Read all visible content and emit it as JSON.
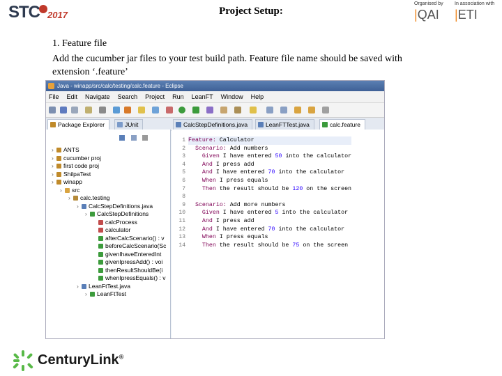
{
  "header": {
    "stc_logo": "STC",
    "stc_year": "2017",
    "title": "Project Setup:",
    "organised_by": "Organised by",
    "org_name": "QAI",
    "assoc_label": "In association with",
    "assoc_name": "ETI"
  },
  "content": {
    "heading": "1.   Feature file",
    "body": "Add the cucumber jar files to your test build path. Feature file name should be saved with extension ‘.feature’"
  },
  "eclipse": {
    "window_title": "Java - winapp/src/calc/testing/calc.feature - Eclipse",
    "menu": [
      "File",
      "Edit",
      "Navigate",
      "Search",
      "Project",
      "Run",
      "LeanFT",
      "Window",
      "Help"
    ],
    "tabs": {
      "package_explorer": "Package Explorer",
      "junit": "JUnit",
      "calc_step_defs": "CalcStepDefinitions.java",
      "leanft_test": "LeanFTTest.java",
      "calc_feature": "calc.feature"
    },
    "tree": [
      {
        "label": "ANTS",
        "indent": 0,
        "color": "#c08a2a"
      },
      {
        "label": "cucumber proj",
        "indent": 0,
        "color": "#c08a2a"
      },
      {
        "label": "first code proj",
        "indent": 0,
        "color": "#c08a2a"
      },
      {
        "label": "ShilpaTest",
        "indent": 0,
        "color": "#c08a2a"
      },
      {
        "label": "winapp",
        "indent": 0,
        "color": "#c08a2a"
      },
      {
        "label": "src",
        "indent": 1,
        "color": "#d9a441"
      },
      {
        "label": "calc.testing",
        "indent": 2,
        "color": "#b58a3a"
      },
      {
        "label": "CalcStepDefinitions.java",
        "indent": 3,
        "color": "#5a7fb8"
      },
      {
        "label": "CalcStepDefinitions",
        "indent": 4,
        "color": "#3c9b3c"
      },
      {
        "label": "calcProcess",
        "indent": 5,
        "color": "#c24c4c"
      },
      {
        "label": "calculator",
        "indent": 5,
        "color": "#c24c4c"
      },
      {
        "label": "afterCalcScenario() : v",
        "indent": 5,
        "color": "#3c9b3c"
      },
      {
        "label": "beforeCalcScenario(Sc",
        "indent": 5,
        "color": "#3c9b3c"
      },
      {
        "label": "givenIhaveEnteredInt",
        "indent": 5,
        "color": "#3c9b3c"
      },
      {
        "label": "givenIpressAdd() : voi",
        "indent": 5,
        "color": "#3c9b3c"
      },
      {
        "label": "thenResultShouldBe(i",
        "indent": 5,
        "color": "#3c9b3c"
      },
      {
        "label": "whenIpressEquals() : v",
        "indent": 5,
        "color": "#3c9b3c"
      },
      {
        "label": "LeanFtTest.java",
        "indent": 3,
        "color": "#5a7fb8"
      },
      {
        "label": "LeanFtTest",
        "indent": 4,
        "color": "#3c9b3c"
      }
    ],
    "code_lines": [
      {
        "n": "1",
        "text": "Feature: Calculator",
        "kw": "Feature:"
      },
      {
        "n": "2",
        "text": "  Scenario: Add numbers",
        "kw": "Scenario:"
      },
      {
        "n": "3",
        "text": "    Given I have entered 50 into the calculator",
        "kw": "Given"
      },
      {
        "n": "4",
        "text": "    And I press add",
        "kw": "And"
      },
      {
        "n": "5",
        "text": "    And I have entered 70 into the calculator",
        "kw": "And"
      },
      {
        "n": "6",
        "text": "    When I press equals",
        "kw": "When"
      },
      {
        "n": "7",
        "text": "    Then the result should be 120 on the screen",
        "kw": "Then"
      },
      {
        "n": "8",
        "text": "",
        "kw": ""
      },
      {
        "n": "9",
        "text": "  Scenario: Add more numbers",
        "kw": "Scenario:"
      },
      {
        "n": "10",
        "text": "    Given I have entered 5 into the calculator",
        "kw": "Given"
      },
      {
        "n": "11",
        "text": "    And I press add",
        "kw": "And"
      },
      {
        "n": "12",
        "text": "    And I have entered 70 into the calculator",
        "kw": "And"
      },
      {
        "n": "13",
        "text": "    When I press equals",
        "kw": "When"
      },
      {
        "n": "14",
        "text": "    Then the result should be 75 on the screen",
        "kw": "Then"
      }
    ]
  },
  "footer": {
    "brand": "CenturyLink",
    "brand_mark": "®"
  },
  "colors": {
    "accent_orange": "#f08a24",
    "stc_red": "#c0392b",
    "centurylink_green": "#58b947"
  },
  "icons": [
    "centurylink-logo-icon",
    "stc-logo-icon",
    "java-perspective-icon"
  ]
}
